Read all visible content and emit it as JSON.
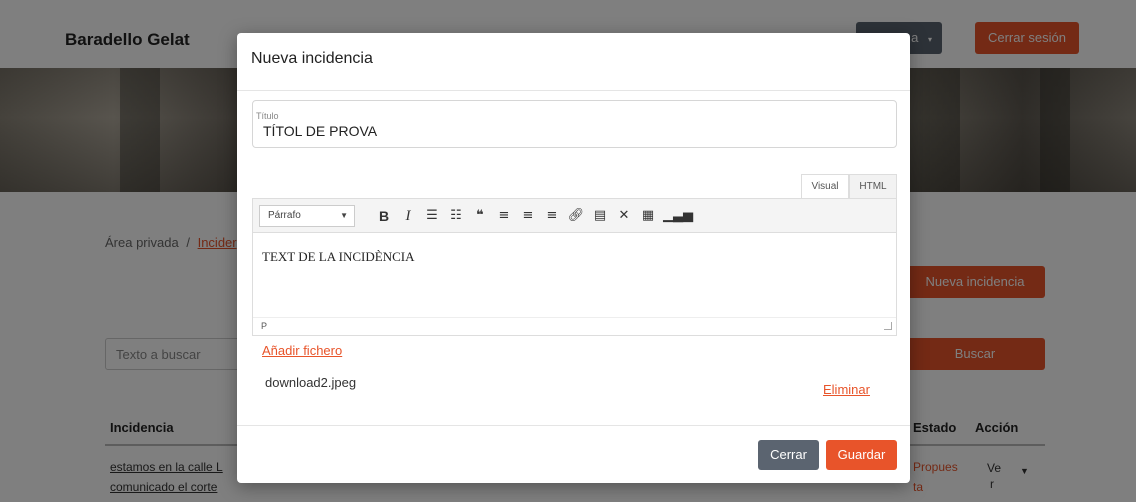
{
  "navbar": {
    "brand": "Baradello Gelat",
    "dropdown_label": "a",
    "logout_label": "Cerrar sesión"
  },
  "page": {
    "breadcrumb_root": "Área privada",
    "breadcrumb_separator": "/",
    "breadcrumb_current": "Incider",
    "new_incident_label": "Nueva incidencia",
    "search_placeholder": "Texto a buscar",
    "search_button": "Buscar",
    "table": {
      "headers": [
        "Incidencia",
        "Estado",
        "Acción"
      ],
      "rows": [
        {
          "incidencia_line1": "estamos en la calle L",
          "incidencia_line2": "comunicado el corte",
          "estado_line1": "Propues",
          "estado_line2": "ta",
          "accion_line1": "Ve",
          "accion_line2": "r"
        }
      ]
    }
  },
  "modal": {
    "title": "Nueva incidencia",
    "title_field": {
      "label": "Título",
      "value": "TÍTOL DE PROVA"
    },
    "editor": {
      "tabs": [
        "Visual",
        "HTML"
      ],
      "active_tab": "Visual",
      "format_select": "Párrafo",
      "toolbar_icons": [
        "bold-icon",
        "italic-icon",
        "bullet-list-icon",
        "numbered-list-icon",
        "blockquote-icon",
        "align-left-icon",
        "align-center-icon",
        "align-right-icon",
        "link-icon",
        "read-more-icon",
        "fullscreen-icon",
        "toolbar-toggle-icon",
        "chart-icon"
      ],
      "content": "TEXT DE LA INCIDÈNCIA",
      "status_path": "P"
    },
    "add_file_label": "Añadir fichero",
    "files": [
      {
        "name": "download2.jpeg",
        "delete_label": "Eliminar"
      }
    ],
    "buttons": {
      "close": "Cerrar",
      "save": "Guardar"
    }
  },
  "colors": {
    "accent": "#e8542a",
    "secondary": "#5b6470"
  }
}
